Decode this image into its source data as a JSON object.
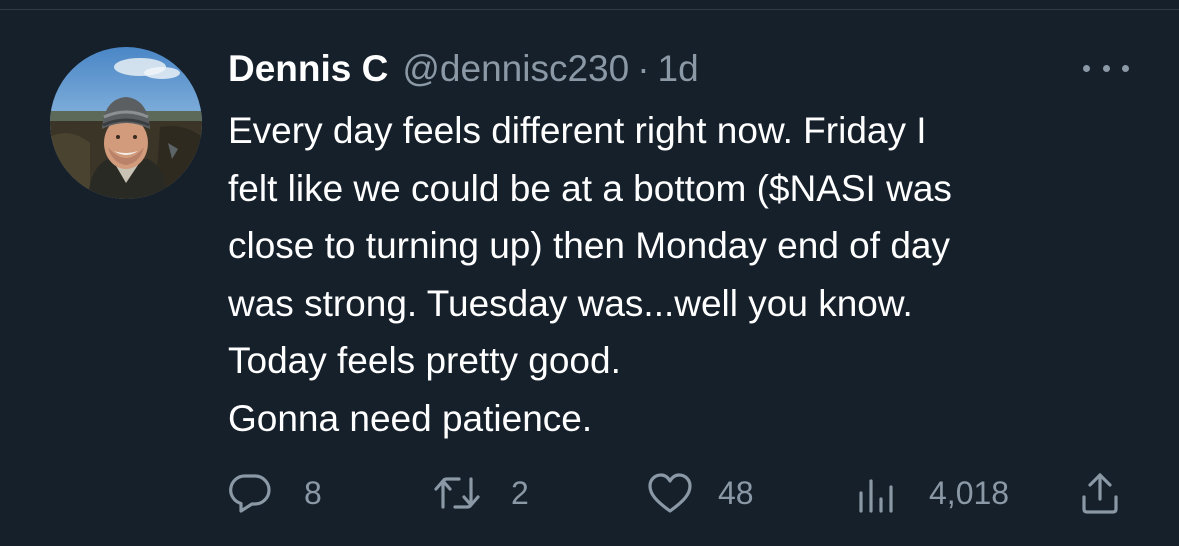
{
  "tweet": {
    "display_name": "Dennis C",
    "handle": "@dennisc230",
    "separator": "·",
    "time": "1d",
    "lines": [
      "Every day feels different right now. Friday I",
      "felt like we could be at a bottom ($NASI was",
      "close to turning up) then Monday end of day",
      "was strong. Tuesday was...well you know.",
      "Today feels pretty good.",
      "Gonna need patience."
    ]
  },
  "actions": {
    "replies": "8",
    "retweets": "2",
    "likes": "48",
    "views": "4,018"
  },
  "icons": {
    "reply": "reply-icon",
    "retweet": "retweet-icon",
    "like": "heart-icon",
    "views": "views-chart-icon",
    "share": "share-icon",
    "more": "more-options-icon"
  },
  "colors": {
    "background": "#15202b",
    "text": "#ffffff",
    "secondary": "#8b98a5"
  }
}
